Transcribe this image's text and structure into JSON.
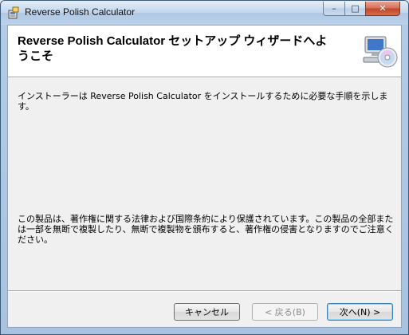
{
  "window": {
    "title": "Reverse Polish Calculator",
    "controls": {
      "minimize": "–",
      "maximize": "□",
      "close": "✕"
    }
  },
  "banner": {
    "title": "Reverse Polish Calculator セットアップ ウィザードへようこそ"
  },
  "body": {
    "intro": "インストーラーは Reverse Polish Calculator をインストールするために必要な手順を示します。",
    "copyright": "この製品は、著作権に関する法律および国際条約により保護されています。この製品の全部または一部を無断で複製したり、無断で複製物を頒布すると、著作権の侵害となりますのでご注意ください。"
  },
  "buttons": {
    "cancel": "キャンセル",
    "back": "< 戻る(B)",
    "next": "次へ(N) >"
  },
  "icons": {
    "app": "setup-app-icon",
    "banner": "computer-cd-icon"
  }
}
